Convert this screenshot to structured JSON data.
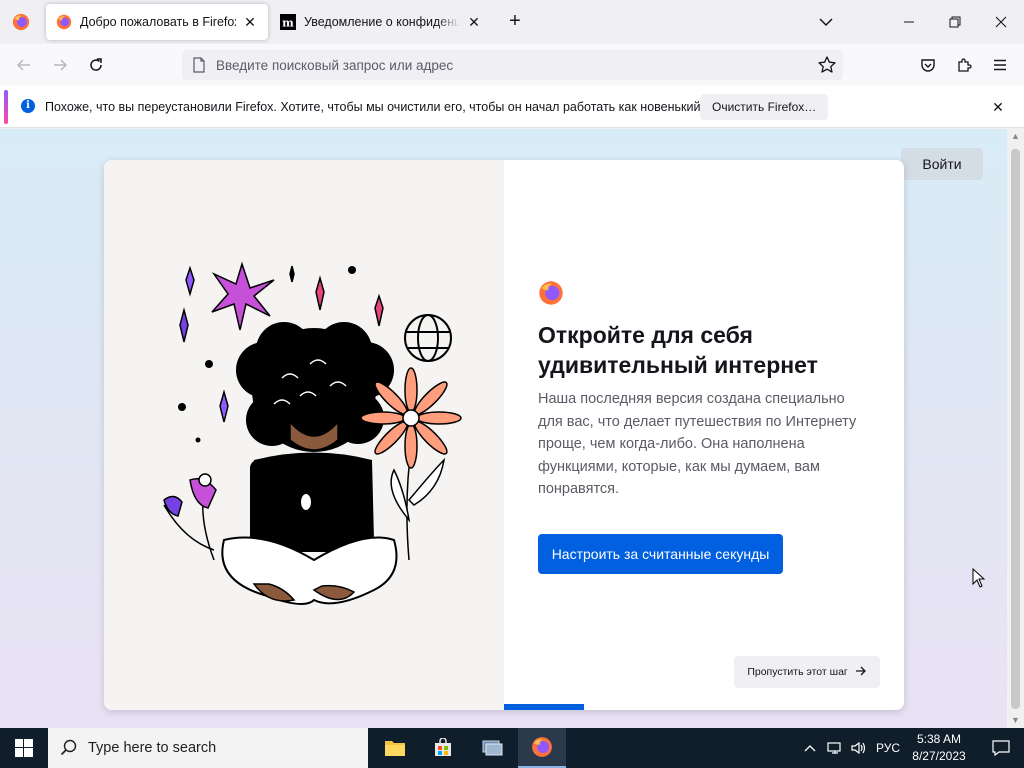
{
  "tabs": [
    {
      "label": "Добро пожаловать в Firefox",
      "active": true
    },
    {
      "label": "Уведомление о конфиденциальности",
      "active": false
    }
  ],
  "urlbar": {
    "placeholder": "Введите поисковый запрос или адрес"
  },
  "notification": {
    "message": "Похоже, что вы переустановили Firefox. Хотите, чтобы мы очистили его, чтобы он начал работать как новенький?",
    "button_label": "Очистить Firefox…"
  },
  "page": {
    "signin_label": "Войти",
    "title": "Откройте для себя удивительный интернет",
    "subtitle": "Наша последняя версия создана специально для вас, что делает путешествия по Интернету проще, чем когда-либо. Она наполнена функциями, которые, как мы думаем, вам понравятся.",
    "primary_button": "Настроить за считанные секунды",
    "skip_button": "Пропустить этот шаг",
    "progress": 0.2
  },
  "taskbar": {
    "search_placeholder": "Type here to search",
    "language": "РУС",
    "time": "5:38 AM",
    "date": "8/27/2023"
  },
  "colors": {
    "accent": "#0060df",
    "taskbar": "#101d2b"
  },
  "icons": [
    "firefox-icon",
    "tab-close-icon",
    "new-tab-icon",
    "list-all-tabs-icon",
    "minimize-icon",
    "maximize-icon",
    "window-close-icon",
    "back-icon",
    "forward-icon",
    "reload-icon",
    "page-icon",
    "bookmark-star-icon",
    "pocket-icon",
    "extensions-icon",
    "menu-icon",
    "info-icon",
    "windows-start-icon",
    "search-icon",
    "file-explorer-icon",
    "store-icon",
    "network-icon",
    "volume-icon"
  ]
}
